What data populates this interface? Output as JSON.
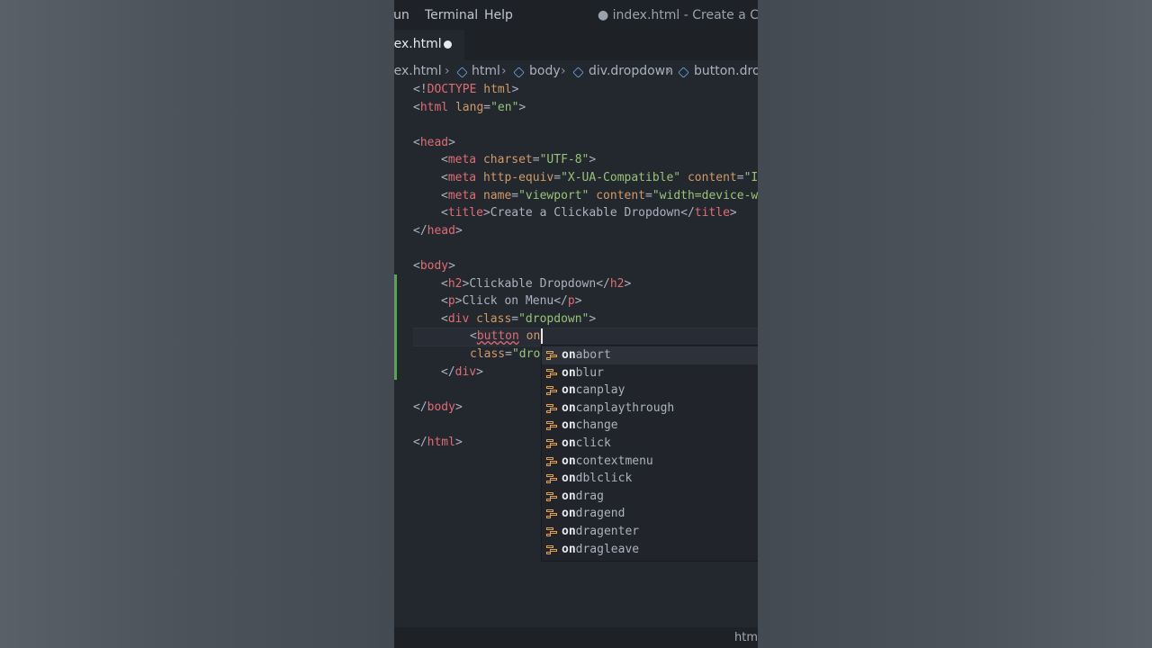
{
  "menubar": {
    "run": "Run",
    "terminal": "Terminal",
    "help": "Help",
    "window_title": "● index.html - Create a Clickable"
  },
  "tab": {
    "label": "index.html"
  },
  "breadcrumb": [
    "index.html",
    "html",
    "body",
    "div.dropdown",
    "button.drop"
  ],
  "code": {
    "l1": [
      "<!",
      "DOCTYPE",
      " ",
      "html",
      ">"
    ],
    "l2": [
      "<",
      "html",
      " ",
      "lang",
      "=",
      "\"en\"",
      ">"
    ],
    "l4": [
      "<",
      "head",
      ">"
    ],
    "l5": [
      "<",
      "meta",
      " ",
      "charset",
      "=",
      "\"UTF-8\"",
      ">"
    ],
    "l6": [
      "<",
      "meta",
      " ",
      "http-equiv",
      "=",
      "\"X-UA-Compatible\"",
      " ",
      "content",
      "=",
      "\"I"
    ],
    "l7": [
      "<",
      "meta",
      " ",
      "name",
      "=",
      "\"viewport\"",
      " ",
      "content",
      "=",
      "\"width=device-w"
    ],
    "l8": [
      "<",
      "title",
      ">",
      "Create a Clickable Dropdown",
      "</",
      "title",
      ">"
    ],
    "l9": [
      "</",
      "head",
      ">"
    ],
    "l11": [
      "<",
      "body",
      ">"
    ],
    "l12": [
      "<",
      "h2",
      ">",
      "Clickable Dropdown",
      "</",
      "h2",
      ">"
    ],
    "l13": [
      "<",
      "p",
      ">",
      "Click on Menu",
      "</",
      "p",
      ">"
    ],
    "l14": [
      "<",
      "div",
      " ",
      "class",
      "=",
      "\"dropdown\"",
      ">"
    ],
    "l15": [
      "<",
      "button",
      " ",
      "on"
    ],
    "l16": [
      "class",
      "=",
      "\"dro"
    ],
    "l17": [
      "</",
      "div",
      ">"
    ],
    "l19": [
      "</",
      "body",
      ">"
    ],
    "l21": [
      "</",
      "html",
      ">"
    ]
  },
  "suggestions": [
    {
      "match": "on",
      "rest": "abort"
    },
    {
      "match": "on",
      "rest": "blur"
    },
    {
      "match": "on",
      "rest": "canplay"
    },
    {
      "match": "on",
      "rest": "canplaythrough"
    },
    {
      "match": "on",
      "rest": "change"
    },
    {
      "match": "on",
      "rest": "click"
    },
    {
      "match": "on",
      "rest": "contextmenu"
    },
    {
      "match": "on",
      "rest": "dblclick"
    },
    {
      "match": "on",
      "rest": "drag"
    },
    {
      "match": "on",
      "rest": "dragend"
    },
    {
      "match": "on",
      "rest": "dragenter"
    },
    {
      "match": "on",
      "rest": "dragleave"
    }
  ],
  "statusbar": {
    "language": "htm"
  }
}
